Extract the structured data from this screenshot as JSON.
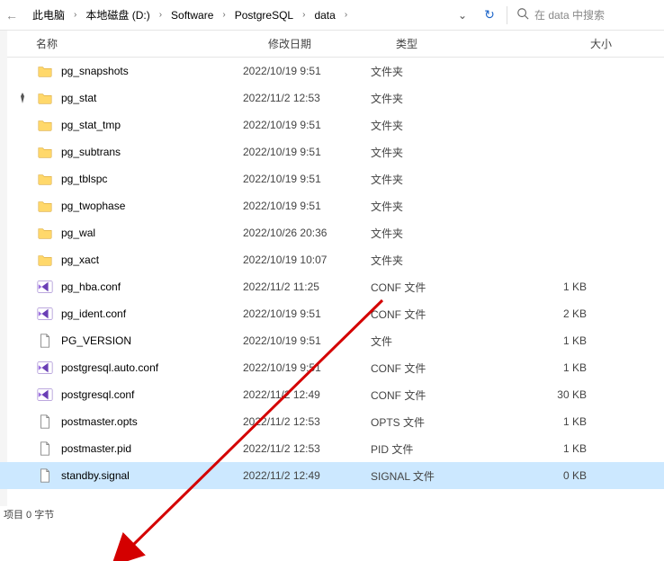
{
  "breadcrumbs": [
    "此电脑",
    "本地磁盘 (D:)",
    "Software",
    "PostgreSQL",
    "data"
  ],
  "search": {
    "placeholder": "在 data 中搜索"
  },
  "columns": {
    "name": "名称",
    "date": "修改日期",
    "type": "类型",
    "size": "大小"
  },
  "rows": [
    {
      "icon": "folder",
      "name": "pg_snapshots",
      "date": "2022/10/19 9:51",
      "type": "文件夹",
      "size": ""
    },
    {
      "icon": "folder",
      "name": "pg_stat",
      "date": "2022/11/2 12:53",
      "type": "文件夹",
      "size": ""
    },
    {
      "icon": "folder",
      "name": "pg_stat_tmp",
      "date": "2022/10/19 9:51",
      "type": "文件夹",
      "size": ""
    },
    {
      "icon": "folder",
      "name": "pg_subtrans",
      "date": "2022/10/19 9:51",
      "type": "文件夹",
      "size": ""
    },
    {
      "icon": "folder",
      "name": "pg_tblspc",
      "date": "2022/10/19 9:51",
      "type": "文件夹",
      "size": ""
    },
    {
      "icon": "folder",
      "name": "pg_twophase",
      "date": "2022/10/19 9:51",
      "type": "文件夹",
      "size": ""
    },
    {
      "icon": "folder",
      "name": "pg_wal",
      "date": "2022/10/26 20:36",
      "type": "文件夹",
      "size": ""
    },
    {
      "icon": "folder",
      "name": "pg_xact",
      "date": "2022/10/19 10:07",
      "type": "文件夹",
      "size": ""
    },
    {
      "icon": "vs",
      "name": "pg_hba.conf",
      "date": "2022/11/2 11:25",
      "type": "CONF 文件",
      "size": "1 KB"
    },
    {
      "icon": "vs",
      "name": "pg_ident.conf",
      "date": "2022/10/19 9:51",
      "type": "CONF 文件",
      "size": "2 KB"
    },
    {
      "icon": "file",
      "name": "PG_VERSION",
      "date": "2022/10/19 9:51",
      "type": "文件",
      "size": "1 KB"
    },
    {
      "icon": "vs",
      "name": "postgresql.auto.conf",
      "date": "2022/10/19 9:51",
      "type": "CONF 文件",
      "size": "1 KB"
    },
    {
      "icon": "vs",
      "name": "postgresql.conf",
      "date": "2022/11/2 12:49",
      "type": "CONF 文件",
      "size": "30 KB"
    },
    {
      "icon": "file",
      "name": "postmaster.opts",
      "date": "2022/11/2 12:53",
      "type": "OPTS 文件",
      "size": "1 KB"
    },
    {
      "icon": "file",
      "name": "postmaster.pid",
      "date": "2022/11/2 12:53",
      "type": "PID 文件",
      "size": "1 KB"
    },
    {
      "icon": "file",
      "name": "standby.signal",
      "date": "2022/11/2 12:49",
      "type": "SIGNAL 文件",
      "size": "0 KB",
      "selected": true
    }
  ],
  "status": "项目  0 字节",
  "pinRow": 1
}
